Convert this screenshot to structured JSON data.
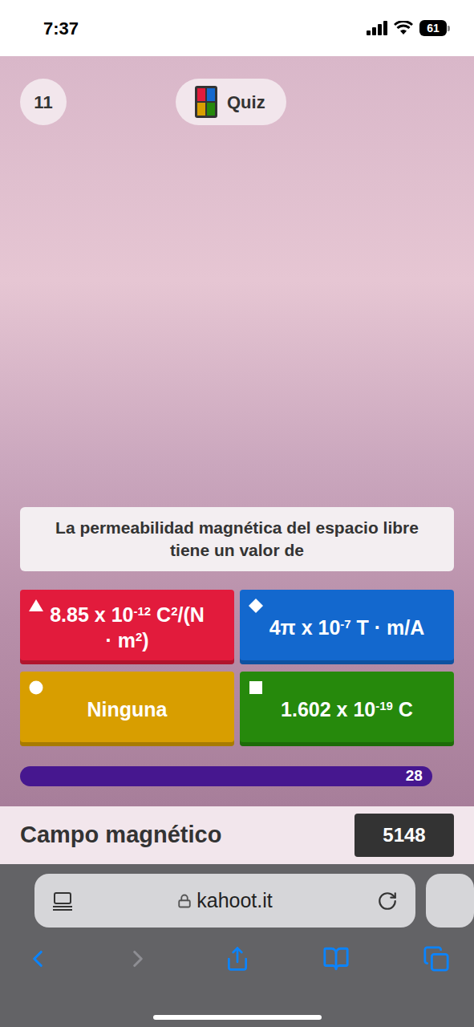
{
  "status_bar": {
    "time": "7:37",
    "battery": "61"
  },
  "question_number": "11",
  "quiz_label": "Quiz",
  "question": "La permeabilidad magnética del espacio libre tiene un valor de",
  "answers": [
    {
      "kind": "triangle",
      "color": "#e21b3c",
      "parts": [
        {
          "text": "8.85 x 10",
          "sup": false
        },
        {
          "text": "-12",
          "sup": true
        },
        {
          "text": " C",
          "sup": false
        },
        {
          "text": "2",
          "sup": true
        },
        {
          "text": "/(N · m",
          "sup": false
        },
        {
          "text": "2",
          "sup": true
        },
        {
          "text": ")",
          "sup": false
        }
      ]
    },
    {
      "kind": "diamond",
      "color": "#1368ce",
      "parts": [
        {
          "text": "4π x 10",
          "sup": false
        },
        {
          "text": "-7",
          "sup": true
        },
        {
          "text": " T · m/A",
          "sup": false
        }
      ]
    },
    {
      "kind": "circle",
      "color": "#d89e00",
      "parts": [
        {
          "text": "Ninguna",
          "sup": false
        }
      ]
    },
    {
      "kind": "square",
      "color": "#26890c",
      "parts": [
        {
          "text": "1.602 x 10",
          "sup": false
        },
        {
          "text": "-19",
          "sup": true
        },
        {
          "text": " C",
          "sup": false
        }
      ]
    }
  ],
  "timer": {
    "value": "28",
    "level": 0.95
  },
  "player": {
    "name": "Campo magnético",
    "score": "5148"
  },
  "browser": {
    "url": "kahoot.it"
  }
}
